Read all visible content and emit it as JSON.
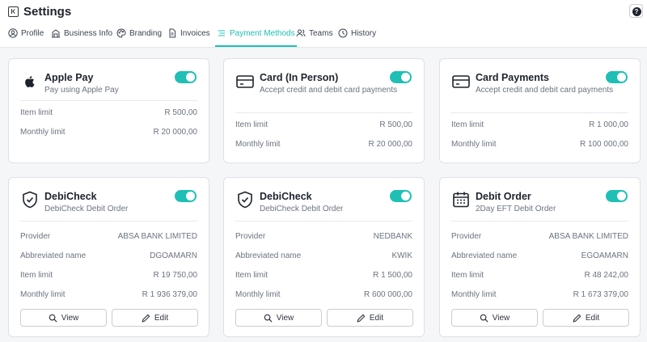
{
  "header": {
    "title": "Settings",
    "help_label": "?"
  },
  "tabs": [
    {
      "label": "Profile"
    },
    {
      "label": "Business Info"
    },
    {
      "label": "Branding"
    },
    {
      "label": "Invoices"
    },
    {
      "label": "Payment Methods"
    },
    {
      "label": "Teams"
    },
    {
      "label": "History"
    }
  ],
  "active_tab": "Payment Methods",
  "accent_color": "#1fbfb5",
  "cards": [
    {
      "icon": "apple-icon",
      "title": "Apple Pay",
      "subtitle": "Pay using Apple Pay",
      "enabled": true,
      "rows": [
        {
          "label": "Item limit",
          "value": "R 500,00"
        },
        {
          "label": "Monthly limit",
          "value": "R 20 000,00"
        }
      ]
    },
    {
      "icon": "card-icon",
      "title": "Card (In Person)",
      "subtitle": "Accept credit and debit card payments",
      "enabled": true,
      "rows": [
        {
          "label": "Item limit",
          "value": "R 500,00"
        },
        {
          "label": "Monthly limit",
          "value": "R 20 000,00"
        }
      ]
    },
    {
      "icon": "card-icon",
      "title": "Card Payments",
      "subtitle": "Accept credit and debit card payments",
      "enabled": true,
      "rows": [
        {
          "label": "Item limit",
          "value": "R 1 000,00"
        },
        {
          "label": "Monthly limit",
          "value": "R 100 000,00"
        }
      ]
    },
    {
      "icon": "shield-check-icon",
      "title": "DebiCheck",
      "subtitle": "DebiCheck Debit Order",
      "enabled": true,
      "rows": [
        {
          "label": "Provider",
          "value": "ABSA BANK LIMITED"
        },
        {
          "label": "Abbreviated name",
          "value": "DGOAMARN"
        },
        {
          "label": "Item limit",
          "value": "R 19 750,00"
        },
        {
          "label": "Monthly limit",
          "value": "R 1 936 379,00"
        }
      ],
      "view_label": "View",
      "edit_label": "Edit"
    },
    {
      "icon": "shield-check-icon",
      "title": "DebiCheck",
      "subtitle": "DebiCheck Debit Order",
      "enabled": true,
      "rows": [
        {
          "label": "Provider",
          "value": "NEDBANK"
        },
        {
          "label": "Abbreviated name",
          "value": "KWIK"
        },
        {
          "label": "Item limit",
          "value": "R 1 500,00"
        },
        {
          "label": "Monthly limit",
          "value": "R 600 000,00"
        }
      ],
      "view_label": "View",
      "edit_label": "Edit"
    },
    {
      "icon": "calendar-icon",
      "title": "Debit Order",
      "subtitle": "2Day EFT Debit Order",
      "enabled": true,
      "rows": [
        {
          "label": "Provider",
          "value": "ABSA BANK LIMITED"
        },
        {
          "label": "Abbreviated name",
          "value": "EGOAMARN"
        },
        {
          "label": "Item limit",
          "value": "R 48 242,00"
        },
        {
          "label": "Monthly limit",
          "value": "R 1 673 379,00"
        }
      ],
      "view_label": "View",
      "edit_label": "Edit"
    }
  ]
}
